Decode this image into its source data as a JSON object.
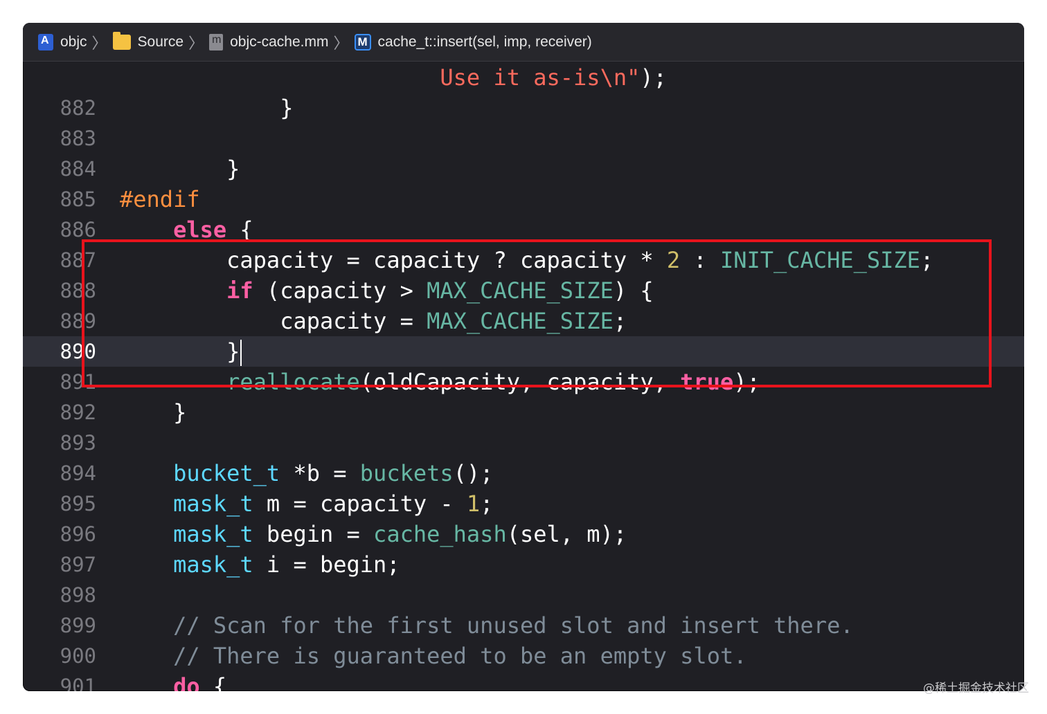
{
  "breadcrumb": [
    {
      "label": "objc",
      "icon": "project-icon"
    },
    {
      "label": "Source",
      "icon": "folder-icon"
    },
    {
      "label": "objc-cache.mm",
      "icon": "objc-file-icon"
    },
    {
      "label": "cache_t::insert(sel, imp, receiver)",
      "icon": "method-icon"
    }
  ],
  "separator": "〉",
  "editor": {
    "current_line": "890",
    "lines": [
      {
        "num": "",
        "tokens": [
          {
            "t": "                        "
          },
          {
            "t": "Use it as-is\\n\"",
            "c": "str"
          },
          {
            "t": ");"
          }
        ]
      },
      {
        "num": "882",
        "tokens": [
          {
            "t": "            }"
          }
        ]
      },
      {
        "num": "883",
        "tokens": []
      },
      {
        "num": "884",
        "tokens": [
          {
            "t": "        }"
          }
        ]
      },
      {
        "num": "885",
        "tokens": [
          {
            "t": "#endif",
            "c": "pp"
          }
        ]
      },
      {
        "num": "886",
        "tokens": [
          {
            "t": "    "
          },
          {
            "t": "else",
            "c": "kw"
          },
          {
            "t": " {"
          }
        ]
      },
      {
        "num": "887",
        "tokens": [
          {
            "t": "        capacity = capacity ? capacity * "
          },
          {
            "t": "2",
            "c": "num"
          },
          {
            "t": " : "
          },
          {
            "t": "INIT_CACHE_SIZE",
            "c": "cst"
          },
          {
            "t": ";"
          }
        ]
      },
      {
        "num": "888",
        "tokens": [
          {
            "t": "        "
          },
          {
            "t": "if",
            "c": "kw"
          },
          {
            "t": " (capacity > "
          },
          {
            "t": "MAX_CACHE_SIZE",
            "c": "cst"
          },
          {
            "t": ") {"
          }
        ]
      },
      {
        "num": "889",
        "tokens": [
          {
            "t": "            capacity = "
          },
          {
            "t": "MAX_CACHE_SIZE",
            "c": "cst"
          },
          {
            "t": ";"
          }
        ]
      },
      {
        "num": "890",
        "tokens": [
          {
            "t": "        }"
          }
        ],
        "caret": true
      },
      {
        "num": "891",
        "tokens": [
          {
            "t": "        "
          },
          {
            "t": "reallocate",
            "c": "fn"
          },
          {
            "t": "(oldCapacity, capacity, "
          },
          {
            "t": "true",
            "c": "kw"
          },
          {
            "t": ");"
          }
        ]
      },
      {
        "num": "892",
        "tokens": [
          {
            "t": "    }"
          }
        ]
      },
      {
        "num": "893",
        "tokens": []
      },
      {
        "num": "894",
        "tokens": [
          {
            "t": "    "
          },
          {
            "t": "bucket_t",
            "c": "ty"
          },
          {
            "t": " *b = "
          },
          {
            "t": "buckets",
            "c": "fn"
          },
          {
            "t": "();"
          }
        ]
      },
      {
        "num": "895",
        "tokens": [
          {
            "t": "    "
          },
          {
            "t": "mask_t",
            "c": "ty"
          },
          {
            "t": " m = capacity - "
          },
          {
            "t": "1",
            "c": "num"
          },
          {
            "t": ";"
          }
        ]
      },
      {
        "num": "896",
        "tokens": [
          {
            "t": "    "
          },
          {
            "t": "mask_t",
            "c": "ty"
          },
          {
            "t": " begin = "
          },
          {
            "t": "cache_hash",
            "c": "fn"
          },
          {
            "t": "(sel, m);"
          }
        ]
      },
      {
        "num": "897",
        "tokens": [
          {
            "t": "    "
          },
          {
            "t": "mask_t",
            "c": "ty"
          },
          {
            "t": " i = begin;"
          }
        ]
      },
      {
        "num": "898",
        "tokens": []
      },
      {
        "num": "899",
        "tokens": [
          {
            "t": "    "
          },
          {
            "t": "// Scan for the first unused slot and insert there.",
            "c": "cmt"
          }
        ]
      },
      {
        "num": "900",
        "tokens": [
          {
            "t": "    "
          },
          {
            "t": "// There is guaranteed to be an empty slot.",
            "c": "cmt"
          }
        ]
      },
      {
        "num": "901",
        "tokens": [
          {
            "t": "    "
          },
          {
            "t": "do",
            "c": "kw"
          },
          {
            "t": " {"
          }
        ]
      }
    ]
  },
  "watermark": "@稀土掘金技术社区",
  "colors": {
    "highlight_box": "#e8131c",
    "editor_bg": "#1f1f24",
    "keyword": "#fc5fa3",
    "preprocessor": "#fd8f3f",
    "string": "#fc6a5d",
    "number": "#d0bf69",
    "function": "#67b7a4",
    "type": "#5dd8ff",
    "comment": "#7f8c98"
  }
}
